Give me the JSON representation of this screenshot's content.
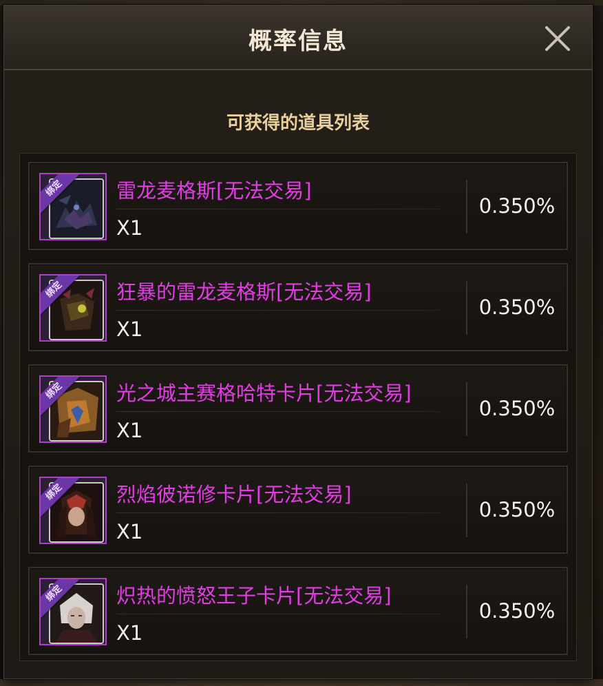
{
  "dialog": {
    "title": "概率信息",
    "subtitle": "可获得的道具列表"
  },
  "icons": {
    "close": "close-icon"
  },
  "colors": {
    "item_name": "#e33be6",
    "rarity_border": "#b43ccd",
    "bind_ribbon": "#6b36a6",
    "title_text": "#f2e7d4",
    "subtitle_text": "#e9cf9d"
  },
  "items": [
    {
      "bind_tag": "绑定",
      "name": "雷龙麦格斯[无法交易]",
      "quantity": "X1",
      "rate": "0.350%"
    },
    {
      "bind_tag": "绑定",
      "name": "狂暴的雷龙麦格斯[无法交易]",
      "quantity": "X1",
      "rate": "0.350%"
    },
    {
      "bind_tag": "绑定",
      "name": "光之城主赛格哈特卡片[无法交易]",
      "quantity": "X1",
      "rate": "0.350%"
    },
    {
      "bind_tag": "绑定",
      "name": "烈焰彼诺修卡片[无法交易]",
      "quantity": "X1",
      "rate": "0.350%"
    },
    {
      "bind_tag": "绑定",
      "name": "炽热的愤怒王子卡片[无法交易]",
      "quantity": "X1",
      "rate": "0.350%"
    }
  ]
}
